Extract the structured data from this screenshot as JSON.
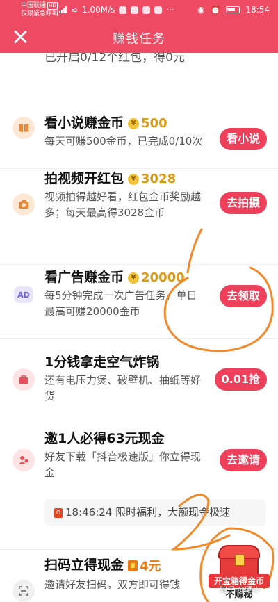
{
  "status_bar": {
    "carrier_line1": "中国联通",
    "carrier_hd": "HD",
    "carrier_line2": "仅限紧急呼叫",
    "net_speed": "1.00M/s",
    "time": "18:54"
  },
  "header": {
    "title": "赚钱任务",
    "close_icon": "close-icon"
  },
  "partial_row_text": "已开启0/12个红包，得0元",
  "tasks": [
    {
      "name": "看小说赚金币",
      "reward": "500",
      "desc": "每天可赚500金币，已完成0/10次",
      "button": "看小说",
      "icon": "book-icon"
    },
    {
      "name": "拍视频开红包",
      "reward": "3028",
      "desc": "视频拍得越好看，红包金币奖励越多；每天最高得3028金币",
      "button": "去拍摄",
      "icon": "camera-icon"
    },
    {
      "name": "看广告赚金币",
      "reward": "20000",
      "desc": "每5分钟完成一次广告任务，单日最高可赚20000金币",
      "button": "去领取",
      "icon": "ad-icon",
      "icon_text": "AD"
    },
    {
      "name": "1分钱拿走空气炸锅",
      "desc": "还有电压力煲、破壁机、抽纸等好货",
      "button": "0.01抢",
      "icon": "shopping-bag-icon"
    },
    {
      "name": "邀1人必得63元现金",
      "desc": "好友下载「抖音极速版」你立得现金",
      "button": "去邀请",
      "icon": "invite-user-icon"
    },
    {
      "name": "扫码立得现金",
      "reward": "4元",
      "desc": "邀请好友扫码，双方即可得钱",
      "icon": "scan-icon"
    }
  ],
  "countdown": {
    "time": "18:46:24",
    "text": "限时福利，大额现金极速"
  },
  "treasure": {
    "label": "开宝箱得金币",
    "sub": "不赚秘"
  },
  "watermark": "知乎 @晒小",
  "colors": {
    "brand": "#ef4a63",
    "button": "#ee3f5b",
    "reward": "#d99b15",
    "annotation": "#f08a2c"
  }
}
